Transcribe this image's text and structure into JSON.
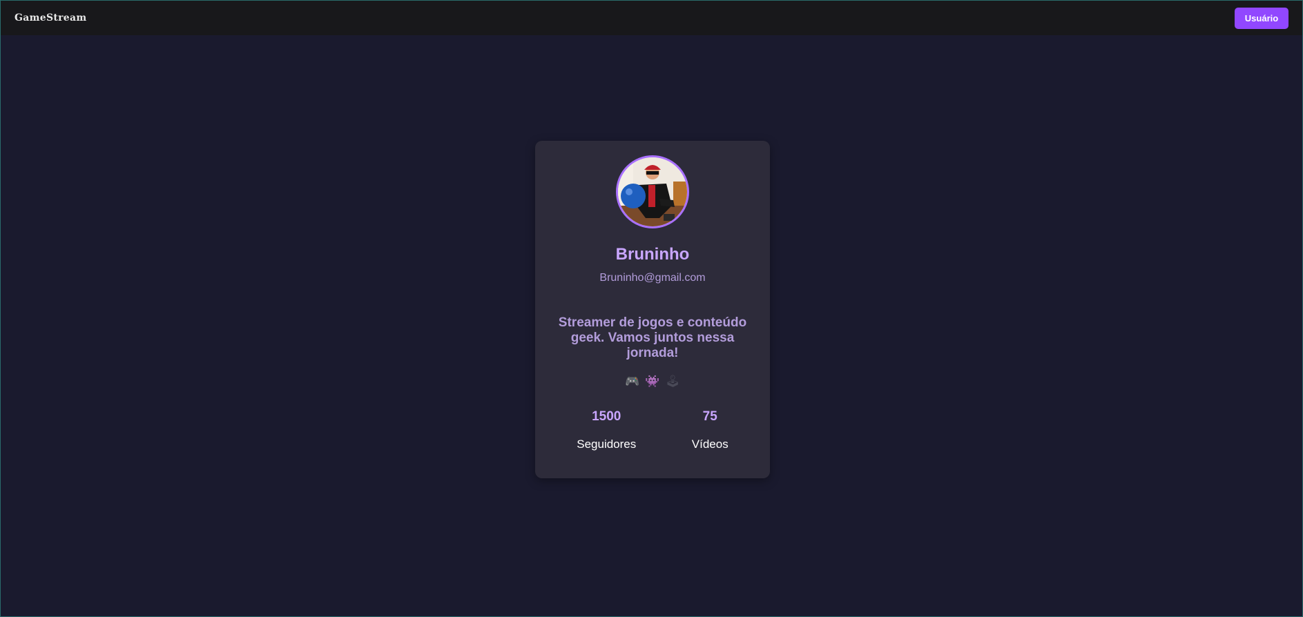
{
  "navbar": {
    "brand": "GameStream",
    "user_button_label": "Usuário"
  },
  "profile": {
    "name": "Bruninho",
    "email": "Bruninho@gmail.com",
    "bio": "Streamer de jogos e conteúdo geek. Vamos juntos nessa jornada!",
    "emojis": [
      {
        "icon": "game-controller-icon",
        "glyph": "🎮"
      },
      {
        "icon": "alien-monster-icon",
        "glyph": "👾"
      },
      {
        "icon": "joystick-icon",
        "glyph": "🕹"
      }
    ],
    "stats": [
      {
        "value": "1500",
        "label": "Seguidores"
      },
      {
        "value": "75",
        "label": "Vídeos"
      }
    ]
  },
  "colors": {
    "accent": "#9147ff",
    "name": "#c9a6ff",
    "page_background": "#1a1a2e",
    "card_background": "#2d2b3a",
    "navbar_background": "#18181b"
  }
}
